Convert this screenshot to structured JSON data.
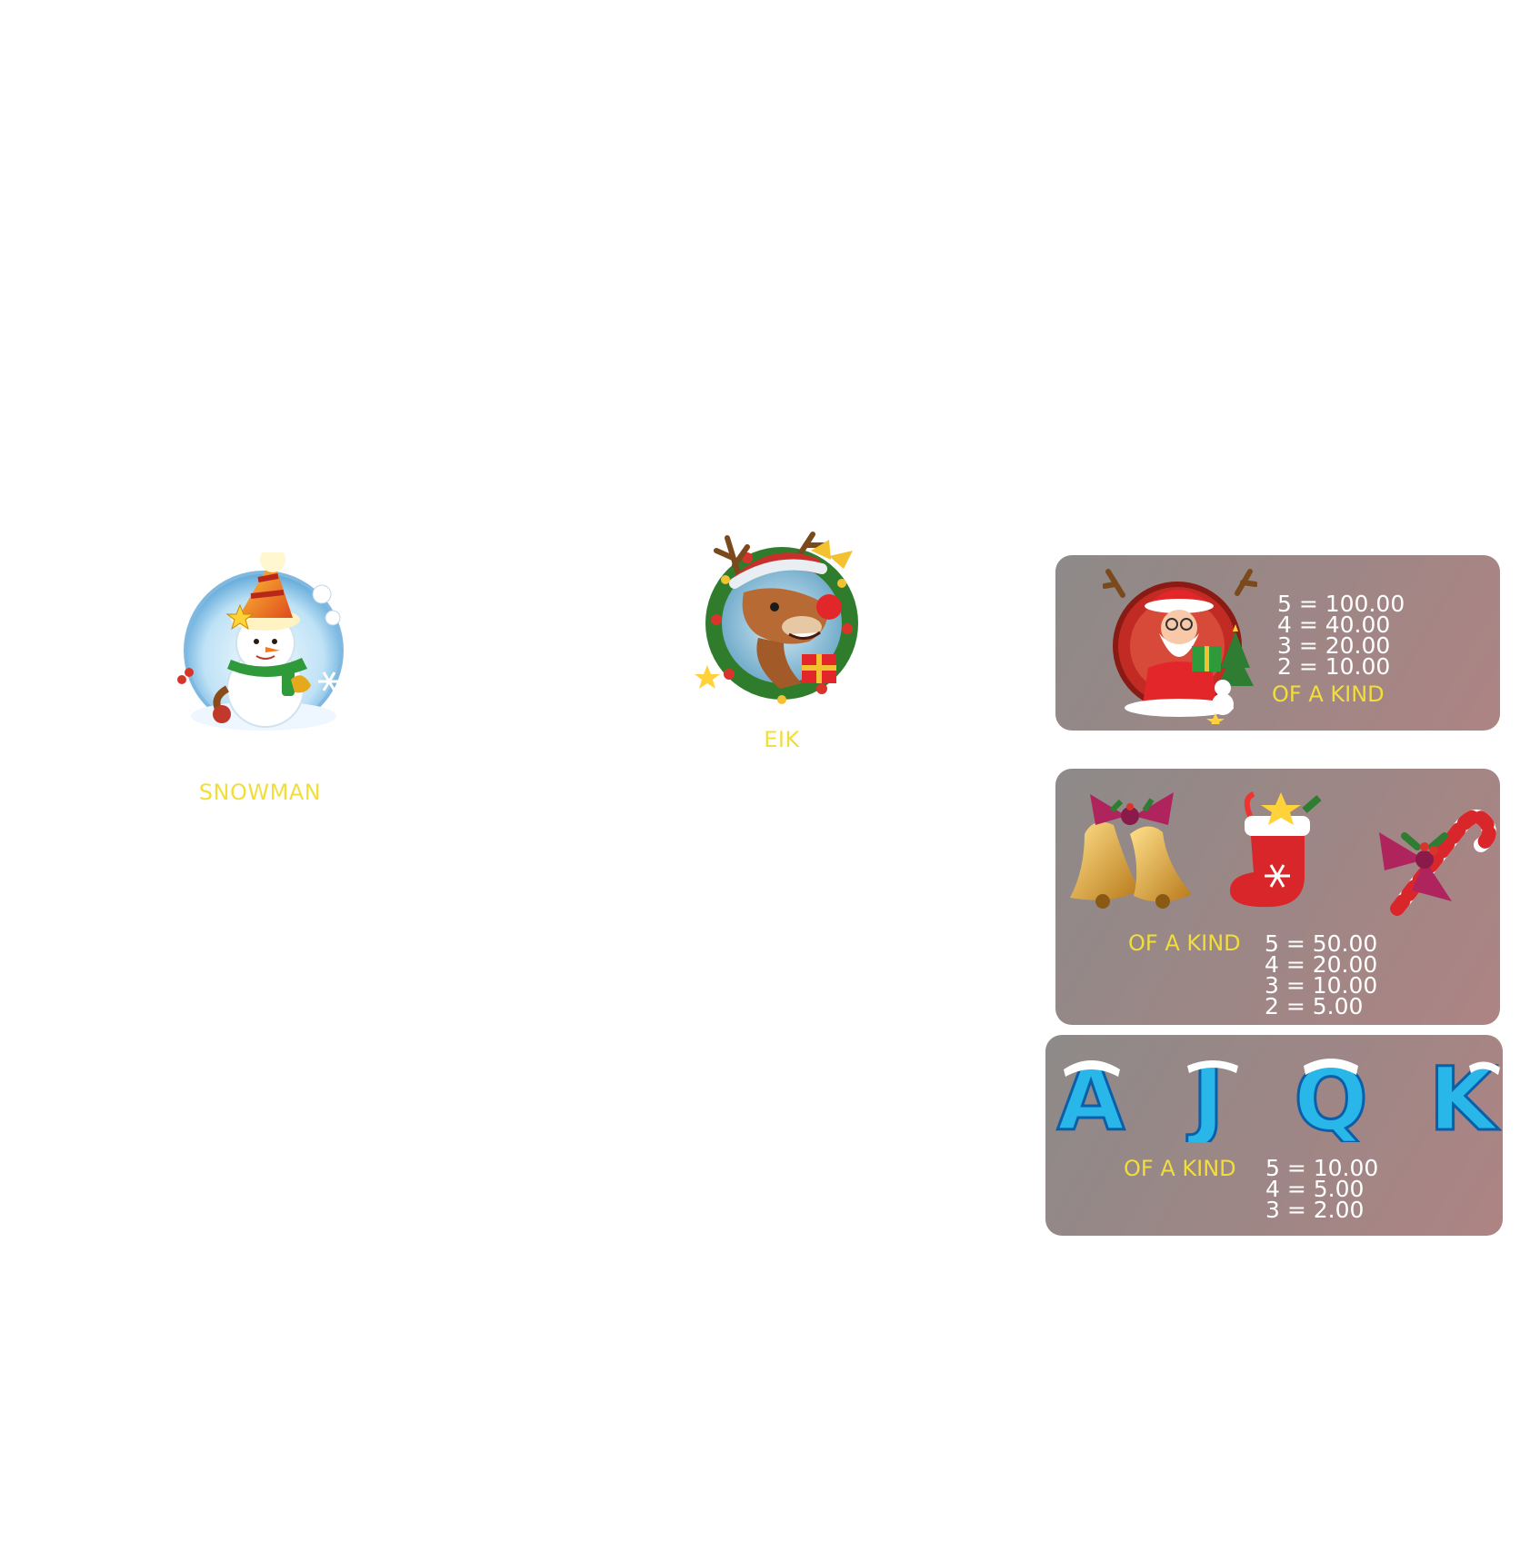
{
  "symbols": [
    {
      "name": "snowman",
      "label": "SNOWMAN",
      "icon": "snowman-icon"
    },
    {
      "name": "elk",
      "label": "EIK",
      "icon": "reindeer-icon"
    }
  ],
  "colors": {
    "label_yellow": "#f2de3a",
    "payout_white": "#ffffff",
    "panel_start": "#8d8a89",
    "panel_end": "#ad8483"
  },
  "paytable": [
    {
      "icons": [
        "santa-icon"
      ],
      "kind_label": "OF A KIND",
      "payouts": [
        "5 = 100.00",
        "4 = 40.00",
        "3 = 20.00",
        "2 = 10.00"
      ]
    },
    {
      "icons": [
        "bells-icon",
        "stocking-icon",
        "candy-cane-icon"
      ],
      "kind_label": "OF A KIND",
      "payouts": [
        "5 = 50.00",
        "4 = 20.00",
        "3 = 10.00",
        "2 = 5.00"
      ]
    },
    {
      "icons": [
        "letter-a-icon",
        "letter-j-icon",
        "letter-q-icon",
        "letter-k-icon"
      ],
      "letters": [
        "A",
        "J",
        "Q",
        "K"
      ],
      "kind_label": "OF A KIND",
      "payouts": [
        "5 = 10.00",
        "4 = 5.00",
        "3 = 2.00"
      ]
    }
  ]
}
